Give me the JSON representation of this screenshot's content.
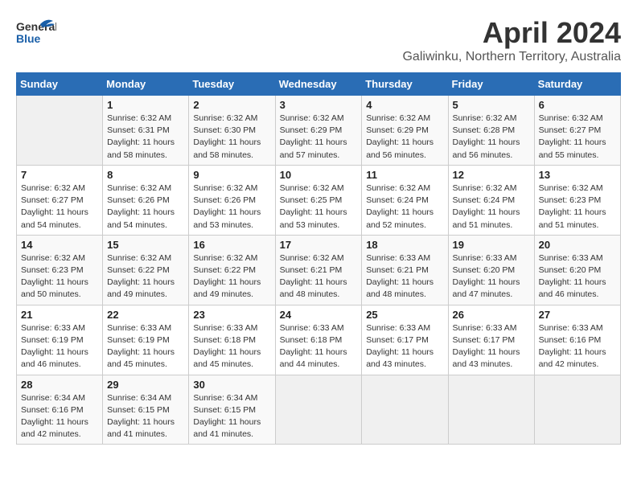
{
  "header": {
    "logo_general": "General",
    "logo_blue": "Blue",
    "month": "April 2024",
    "location": "Galiwinku, Northern Territory, Australia"
  },
  "days_of_week": [
    "Sunday",
    "Monday",
    "Tuesday",
    "Wednesday",
    "Thursday",
    "Friday",
    "Saturday"
  ],
  "weeks": [
    [
      {
        "day": "",
        "info": ""
      },
      {
        "day": "1",
        "info": "Sunrise: 6:32 AM\nSunset: 6:31 PM\nDaylight: 11 hours\nand 58 minutes."
      },
      {
        "day": "2",
        "info": "Sunrise: 6:32 AM\nSunset: 6:30 PM\nDaylight: 11 hours\nand 58 minutes."
      },
      {
        "day": "3",
        "info": "Sunrise: 6:32 AM\nSunset: 6:29 PM\nDaylight: 11 hours\nand 57 minutes."
      },
      {
        "day": "4",
        "info": "Sunrise: 6:32 AM\nSunset: 6:29 PM\nDaylight: 11 hours\nand 56 minutes."
      },
      {
        "day": "5",
        "info": "Sunrise: 6:32 AM\nSunset: 6:28 PM\nDaylight: 11 hours\nand 56 minutes."
      },
      {
        "day": "6",
        "info": "Sunrise: 6:32 AM\nSunset: 6:27 PM\nDaylight: 11 hours\nand 55 minutes."
      }
    ],
    [
      {
        "day": "7",
        "info": "Sunrise: 6:32 AM\nSunset: 6:27 PM\nDaylight: 11 hours\nand 54 minutes."
      },
      {
        "day": "8",
        "info": "Sunrise: 6:32 AM\nSunset: 6:26 PM\nDaylight: 11 hours\nand 54 minutes."
      },
      {
        "day": "9",
        "info": "Sunrise: 6:32 AM\nSunset: 6:26 PM\nDaylight: 11 hours\nand 53 minutes."
      },
      {
        "day": "10",
        "info": "Sunrise: 6:32 AM\nSunset: 6:25 PM\nDaylight: 11 hours\nand 53 minutes."
      },
      {
        "day": "11",
        "info": "Sunrise: 6:32 AM\nSunset: 6:24 PM\nDaylight: 11 hours\nand 52 minutes."
      },
      {
        "day": "12",
        "info": "Sunrise: 6:32 AM\nSunset: 6:24 PM\nDaylight: 11 hours\nand 51 minutes."
      },
      {
        "day": "13",
        "info": "Sunrise: 6:32 AM\nSunset: 6:23 PM\nDaylight: 11 hours\nand 51 minutes."
      }
    ],
    [
      {
        "day": "14",
        "info": "Sunrise: 6:32 AM\nSunset: 6:23 PM\nDaylight: 11 hours\nand 50 minutes."
      },
      {
        "day": "15",
        "info": "Sunrise: 6:32 AM\nSunset: 6:22 PM\nDaylight: 11 hours\nand 49 minutes."
      },
      {
        "day": "16",
        "info": "Sunrise: 6:32 AM\nSunset: 6:22 PM\nDaylight: 11 hours\nand 49 minutes."
      },
      {
        "day": "17",
        "info": "Sunrise: 6:32 AM\nSunset: 6:21 PM\nDaylight: 11 hours\nand 48 minutes."
      },
      {
        "day": "18",
        "info": "Sunrise: 6:33 AM\nSunset: 6:21 PM\nDaylight: 11 hours\nand 48 minutes."
      },
      {
        "day": "19",
        "info": "Sunrise: 6:33 AM\nSunset: 6:20 PM\nDaylight: 11 hours\nand 47 minutes."
      },
      {
        "day": "20",
        "info": "Sunrise: 6:33 AM\nSunset: 6:20 PM\nDaylight: 11 hours\nand 46 minutes."
      }
    ],
    [
      {
        "day": "21",
        "info": "Sunrise: 6:33 AM\nSunset: 6:19 PM\nDaylight: 11 hours\nand 46 minutes."
      },
      {
        "day": "22",
        "info": "Sunrise: 6:33 AM\nSunset: 6:19 PM\nDaylight: 11 hours\nand 45 minutes."
      },
      {
        "day": "23",
        "info": "Sunrise: 6:33 AM\nSunset: 6:18 PM\nDaylight: 11 hours\nand 45 minutes."
      },
      {
        "day": "24",
        "info": "Sunrise: 6:33 AM\nSunset: 6:18 PM\nDaylight: 11 hours\nand 44 minutes."
      },
      {
        "day": "25",
        "info": "Sunrise: 6:33 AM\nSunset: 6:17 PM\nDaylight: 11 hours\nand 43 minutes."
      },
      {
        "day": "26",
        "info": "Sunrise: 6:33 AM\nSunset: 6:17 PM\nDaylight: 11 hours\nand 43 minutes."
      },
      {
        "day": "27",
        "info": "Sunrise: 6:33 AM\nSunset: 6:16 PM\nDaylight: 11 hours\nand 42 minutes."
      }
    ],
    [
      {
        "day": "28",
        "info": "Sunrise: 6:34 AM\nSunset: 6:16 PM\nDaylight: 11 hours\nand 42 minutes."
      },
      {
        "day": "29",
        "info": "Sunrise: 6:34 AM\nSunset: 6:15 PM\nDaylight: 11 hours\nand 41 minutes."
      },
      {
        "day": "30",
        "info": "Sunrise: 6:34 AM\nSunset: 6:15 PM\nDaylight: 11 hours\nand 41 minutes."
      },
      {
        "day": "",
        "info": ""
      },
      {
        "day": "",
        "info": ""
      },
      {
        "day": "",
        "info": ""
      },
      {
        "day": "",
        "info": ""
      }
    ]
  ]
}
